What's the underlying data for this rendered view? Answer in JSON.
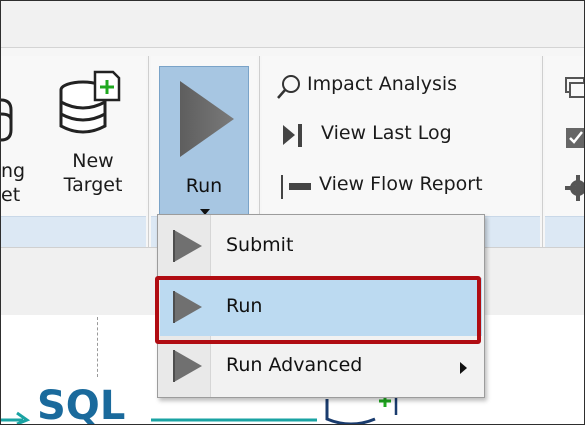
{
  "ribbon": {
    "partial_left_label_top": "ng",
    "partial_left_label_bottom": "et",
    "new_target": {
      "line1": "New",
      "line2": "Target",
      "icon": "database-add-icon"
    },
    "run": {
      "label": "Run",
      "icon": "play-icon",
      "dropdown_icon": "chevron-down-icon"
    },
    "actions": [
      {
        "label": "Impact Analysis",
        "icon": "search-icon"
      },
      {
        "label": "View Last Log",
        "icon": "skip-log-icon"
      },
      {
        "label": "View Flow Report",
        "icon": "flow-report-icon"
      }
    ]
  },
  "menu": {
    "items": [
      {
        "label": "Submit",
        "icon": "play-icon",
        "highlighted": false,
        "has_submenu": false
      },
      {
        "label": "Run",
        "icon": "play-icon",
        "highlighted": true,
        "has_submenu": false
      },
      {
        "label": "Run Advanced",
        "icon": "play-icon",
        "highlighted": false,
        "has_submenu": true
      }
    ]
  },
  "canvas": {
    "partial_text": "SQL"
  },
  "colors": {
    "highlight": "#bcdaf1",
    "focus_border": "#b00c12",
    "run_button": "#a7c6e2",
    "group_footer": "#dce8f4"
  }
}
